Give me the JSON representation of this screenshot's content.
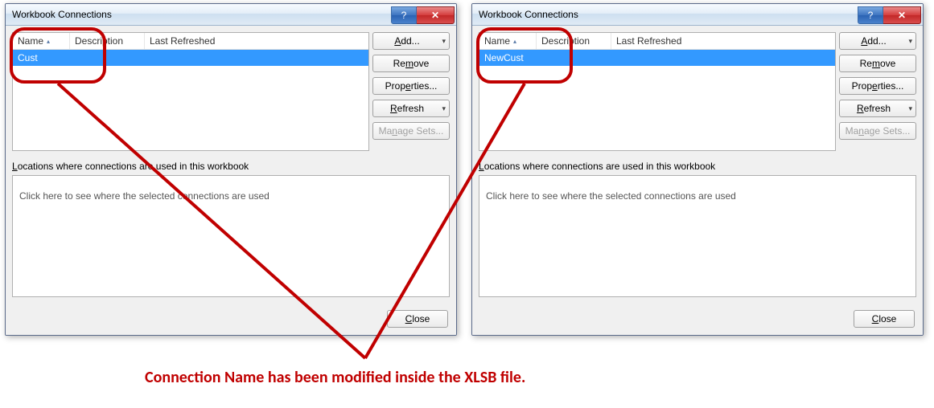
{
  "left_dialog": {
    "title": "Workbook Connections",
    "columns": {
      "name": "Name",
      "description": "Description",
      "last_refreshed": "Last Refreshed"
    },
    "row": {
      "name": "Cust"
    },
    "buttons": {
      "add": "Add...",
      "remove": "Remove",
      "properties": "Properties...",
      "refresh": "Refresh",
      "manage_sets": "Manage Sets..."
    },
    "locations_label": "Locations where connections are used in this workbook",
    "locations_hint": "Click here to see where the selected connections are used",
    "close": "Close"
  },
  "right_dialog": {
    "title": "Workbook Connections",
    "columns": {
      "name": "Name",
      "description": "Description",
      "last_refreshed": "Last Refreshed"
    },
    "row": {
      "name": "NewCust"
    },
    "buttons": {
      "add": "Add...",
      "remove": "Remove",
      "properties": "Properties...",
      "refresh": "Refresh",
      "manage_sets": "Manage Sets..."
    },
    "locations_label": "Locations where connections are used in this workbook",
    "locations_hint": "Click here to see where the selected connections are used",
    "close": "Close"
  },
  "annotation": {
    "text": "Connection Name has been modified inside the XLSB file.",
    "color": "#c00000"
  }
}
